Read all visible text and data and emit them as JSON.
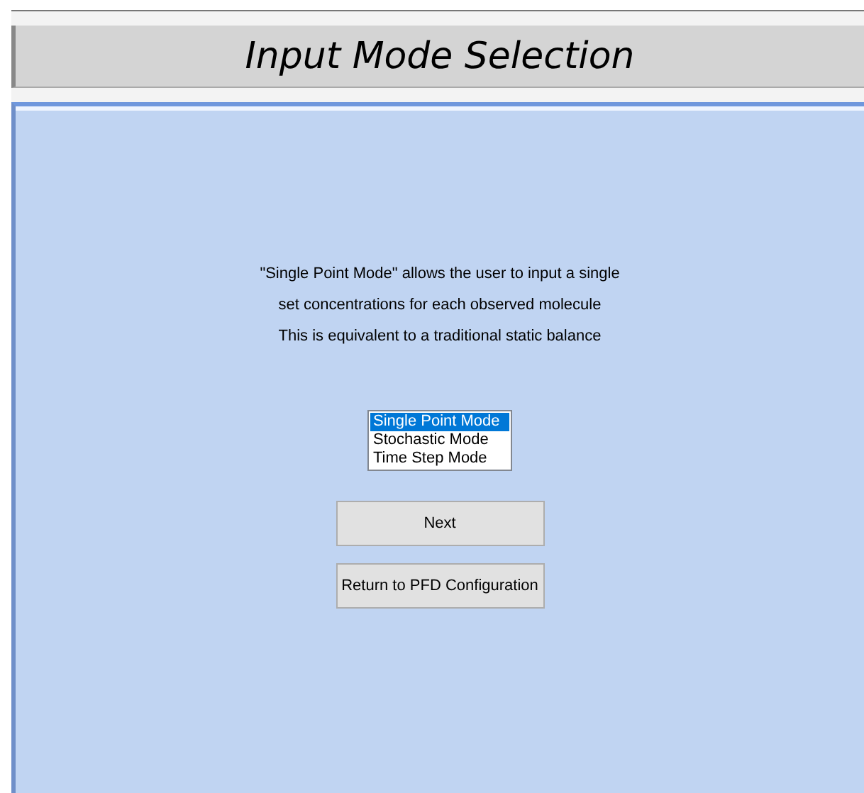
{
  "header": {
    "title": "Input Mode Selection"
  },
  "description": [
    "\"Single Point Mode\" allows the user to input a single",
    "set concentrations for each observed molecule",
    "This is equivalent to a traditional static balance"
  ],
  "modes": [
    {
      "label": "Single Point Mode",
      "selected": true
    },
    {
      "label": "Stochastic Mode",
      "selected": false
    },
    {
      "label": "Time Step Mode",
      "selected": false
    }
  ],
  "buttons": [
    "Next",
    "Return to PFD Configuration"
  ]
}
